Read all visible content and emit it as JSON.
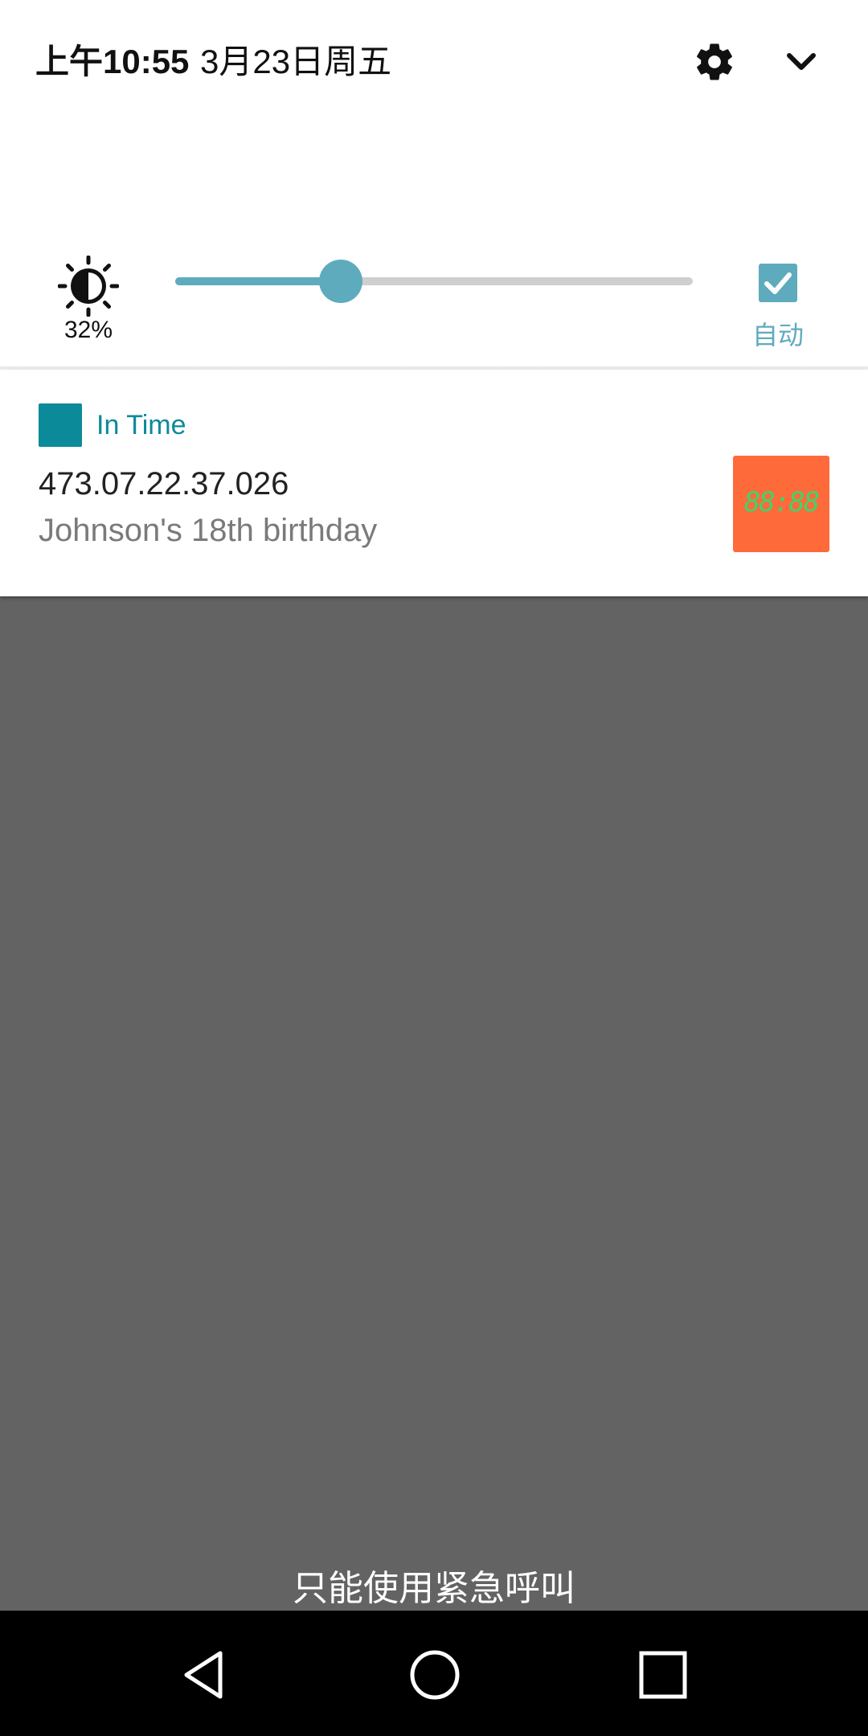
{
  "status_header": {
    "time": "上午10:55",
    "date": "3月23日周五",
    "settings_icon": "gear-icon",
    "expand_icon": "chevron-down-icon"
  },
  "brightness": {
    "icon": "brightness-icon",
    "level_label": "32%",
    "level_fraction": 0.32,
    "auto_checked": true,
    "auto_label": "自动"
  },
  "notification": {
    "app_icon": "app-square-icon",
    "app_name": "In Time",
    "title": "473.07.22.37.026",
    "text": "Johnson's 18th birthday",
    "thumbnail_digits": "88:88",
    "colors": {
      "accent": "#0b8a9a",
      "thumbnail_bg": "#ff6a3a",
      "digits": "#3fd46a"
    }
  },
  "lockscreen": {
    "emergency_text": "只能使用紧急呼叫"
  },
  "nav_bar": {
    "back_icon": "back-triangle-icon",
    "home_icon": "home-circle-icon",
    "recents_icon": "recents-square-icon"
  },
  "colors": {
    "slider_accent": "#5fabbe",
    "scrim": "#636363"
  }
}
